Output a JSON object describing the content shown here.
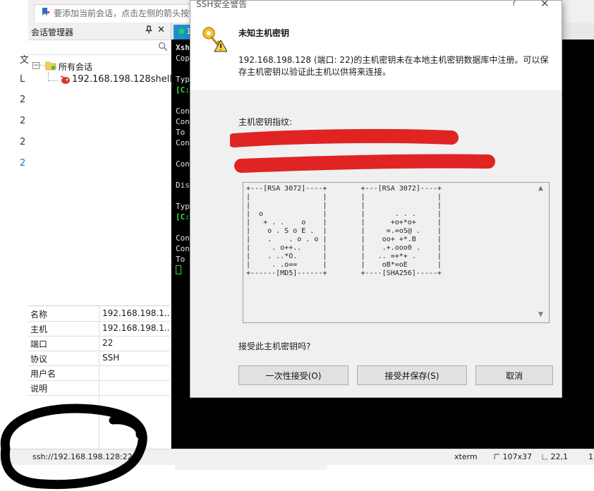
{
  "hint_bar": {
    "text": "要添加当前会话，点击左侧的箭头按钮"
  },
  "left_strip": {
    "items": [
      "文",
      "L",
      "2",
      "2",
      "2",
      "2"
    ]
  },
  "session_manager": {
    "title": "会话管理器",
    "pin_glyph": "ᵖ",
    "close_glyph": "✕",
    "tree": {
      "root_label": "所有会话",
      "expander": "−",
      "session_label": "192.168.198.128shell"
    },
    "properties": [
      {
        "key": "名称",
        "value": "192.168.198.1..."
      },
      {
        "key": "主机",
        "value": "192.168.198.1..."
      },
      {
        "key": "端口",
        "value": "22"
      },
      {
        "key": "协议",
        "value": "SSH"
      },
      {
        "key": "用户名",
        "value": ""
      },
      {
        "key": "说明",
        "value": ""
      }
    ]
  },
  "terminal": {
    "tab_label": "1",
    "lines": [
      "Xsh",
      "Cop",
      "Typ",
      "[C:",
      "Con",
      "Con",
      "To",
      "Con",
      "Con",
      "Dis",
      "Typ",
      "[C:",
      "Con",
      "Con",
      "To"
    ]
  },
  "status_bar": {
    "path": "ssh://192.168.198.128:22",
    "term_type": "xterm",
    "size": "107x37",
    "position": "22,1",
    "extra": "1"
  },
  "dialog": {
    "title": "SSH安全警告",
    "help": "?",
    "close": "✕",
    "heading": "未知主机密钥",
    "message": "192.168.198.128 (端口: 22)的主机密钥未在本地主机密钥数据库中注册。可以保存主机密钥以验证此主机以供将来连接。",
    "fingerprint_label": "主机密钥指纹:",
    "randomart": "+---[RSA 3072]----+        +---[RSA 3072]----+\n|                 |        |                 |\n|                 |        |                 |\n|  o              |        |       . . .     |\n|   + . .    o    |        |      +o+*o+     |\n|    o . S o E .  |        |     =.=oS@ .    |\n|    .    . o . o |        |    oo+ +*.B     |\n|     . o++..     |        |    .+.ooo0 .    |\n|    . ..*O.      |        |   .. =+*+ .     |\n|     . .o==      |        |    oB*=oE       |\n+------[MD5]------+        +----[SHA256]-----+",
    "question": "接受此主机密钥吗?",
    "buttons": {
      "accept_once": "一次性接受(O)",
      "accept_save": "接受并保存(S)",
      "cancel": "取消"
    }
  }
}
